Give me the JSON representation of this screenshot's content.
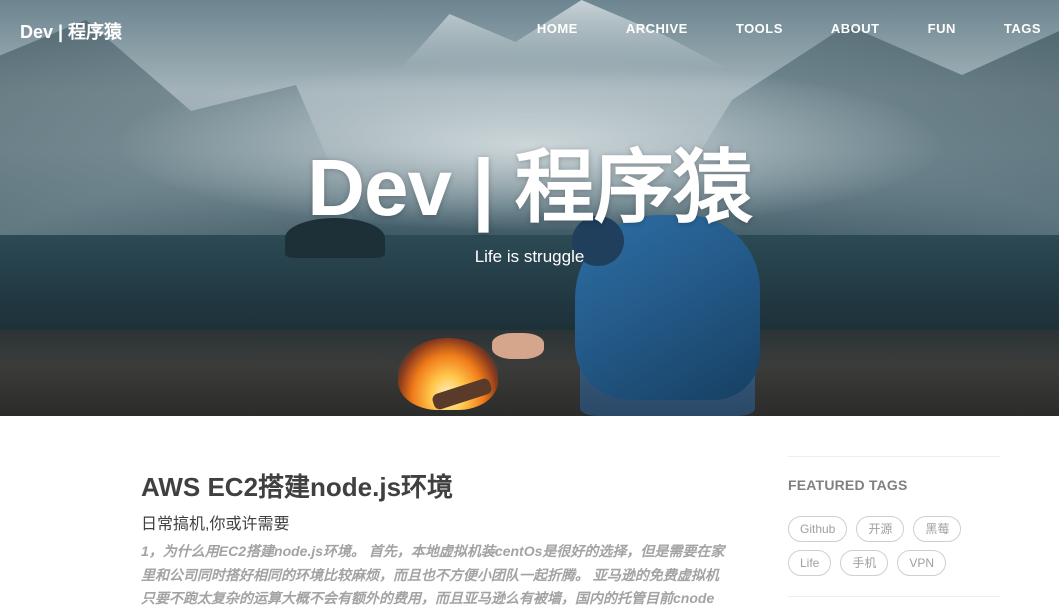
{
  "nav": {
    "brand": "Dev | 程序猿",
    "links": [
      "HOME",
      "ARCHIVE",
      "TOOLS",
      "ABOUT",
      "FUN",
      "TAGS"
    ]
  },
  "hero": {
    "title": "Dev | 程序猿",
    "subtitle": "Life is struggle"
  },
  "post": {
    "title": "AWS EC2搭建node.js环境",
    "subtitle": "日常搞机,你或许需要",
    "excerpt": "1，为什么用EC2搭建node.js环境。 首先，本地虚拟机装centOs是很好的选择，但是需要在家里和公司同时搭好相同的环境比较麻烦，而且也不方便小团队一起折腾。 亚马逊的免费虚拟机只要不跑太复杂的运算大概不会有额外的费用，而且亚马逊么有被墙，国内的托管目前cnode"
  },
  "sidebar": {
    "heading": "FEATURED TAGS",
    "tags": [
      "Github",
      "开源",
      "黑莓",
      "Life",
      "手机",
      "VPN"
    ]
  }
}
